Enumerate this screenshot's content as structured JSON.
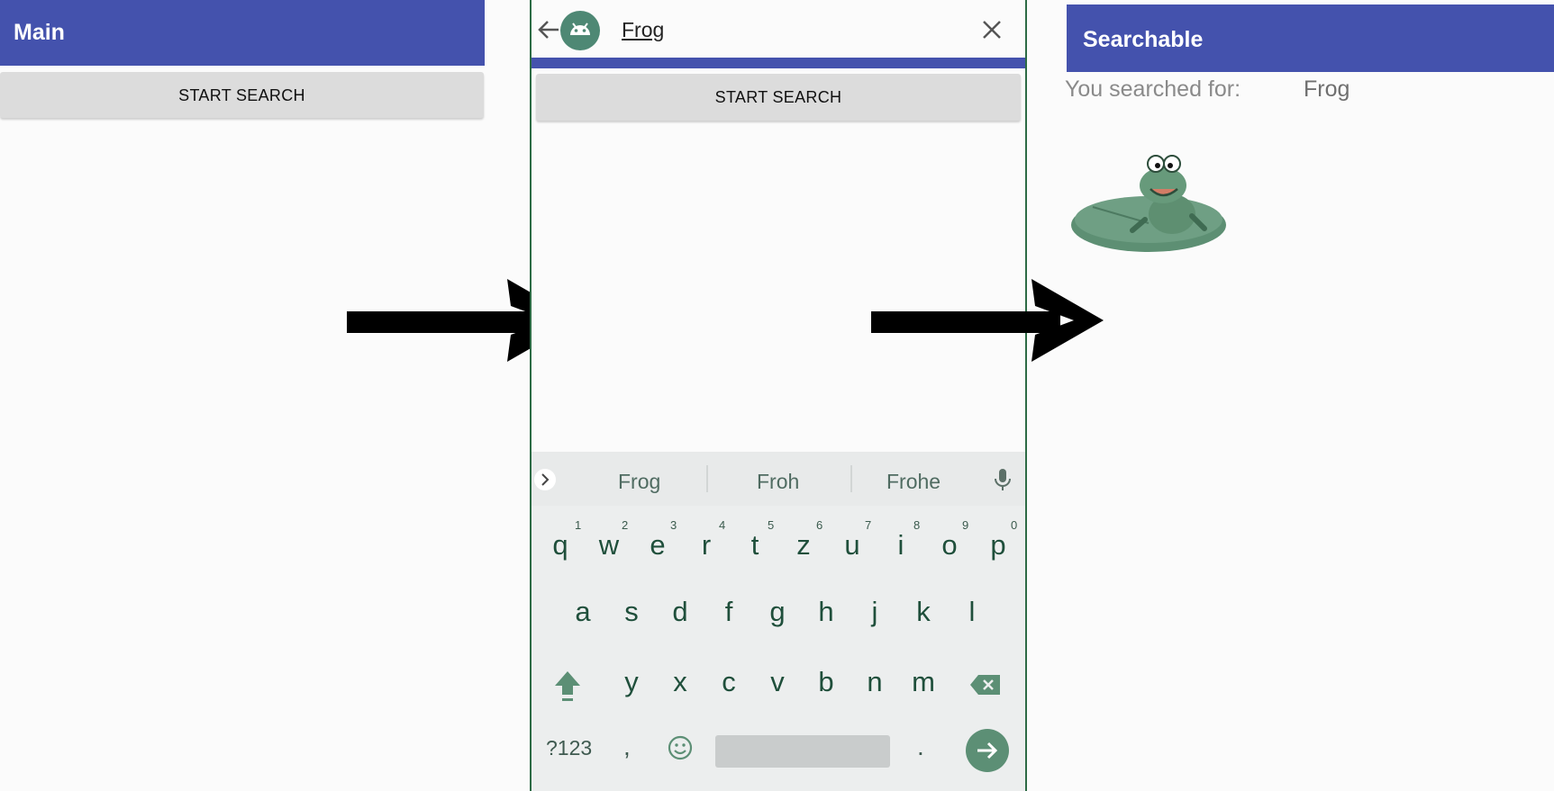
{
  "screen_main": {
    "title": "Main",
    "start_search_label": "START SEARCH"
  },
  "screen_search": {
    "query": "Frog",
    "start_search_label": "START SEARCH",
    "icons": {
      "back": "arrow-back-icon",
      "app": "android-icon",
      "close": "close-icon"
    },
    "keyboard": {
      "suggestions": [
        "Frog",
        "Froh",
        "Frohe"
      ],
      "row1": [
        "q",
        "w",
        "e",
        "r",
        "t",
        "z",
        "u",
        "i",
        "o",
        "p"
      ],
      "row1_numbers": [
        "1",
        "2",
        "3",
        "4",
        "5",
        "6",
        "7",
        "8",
        "9",
        "0"
      ],
      "row2": [
        "a",
        "s",
        "d",
        "f",
        "g",
        "h",
        "j",
        "k",
        "l"
      ],
      "row3": [
        "y",
        "x",
        "c",
        "v",
        "b",
        "n",
        "m"
      ],
      "symbols_key": "?123",
      "comma_key": ",",
      "period_key": "."
    }
  },
  "screen_searchable": {
    "title": "Searchable",
    "result_label": "You searched for:",
    "result_value": "Frog"
  },
  "colors": {
    "app_bar": "#4452ad",
    "keyboard_accent": "#5c8f75",
    "key_text": "#1f4f3b"
  }
}
